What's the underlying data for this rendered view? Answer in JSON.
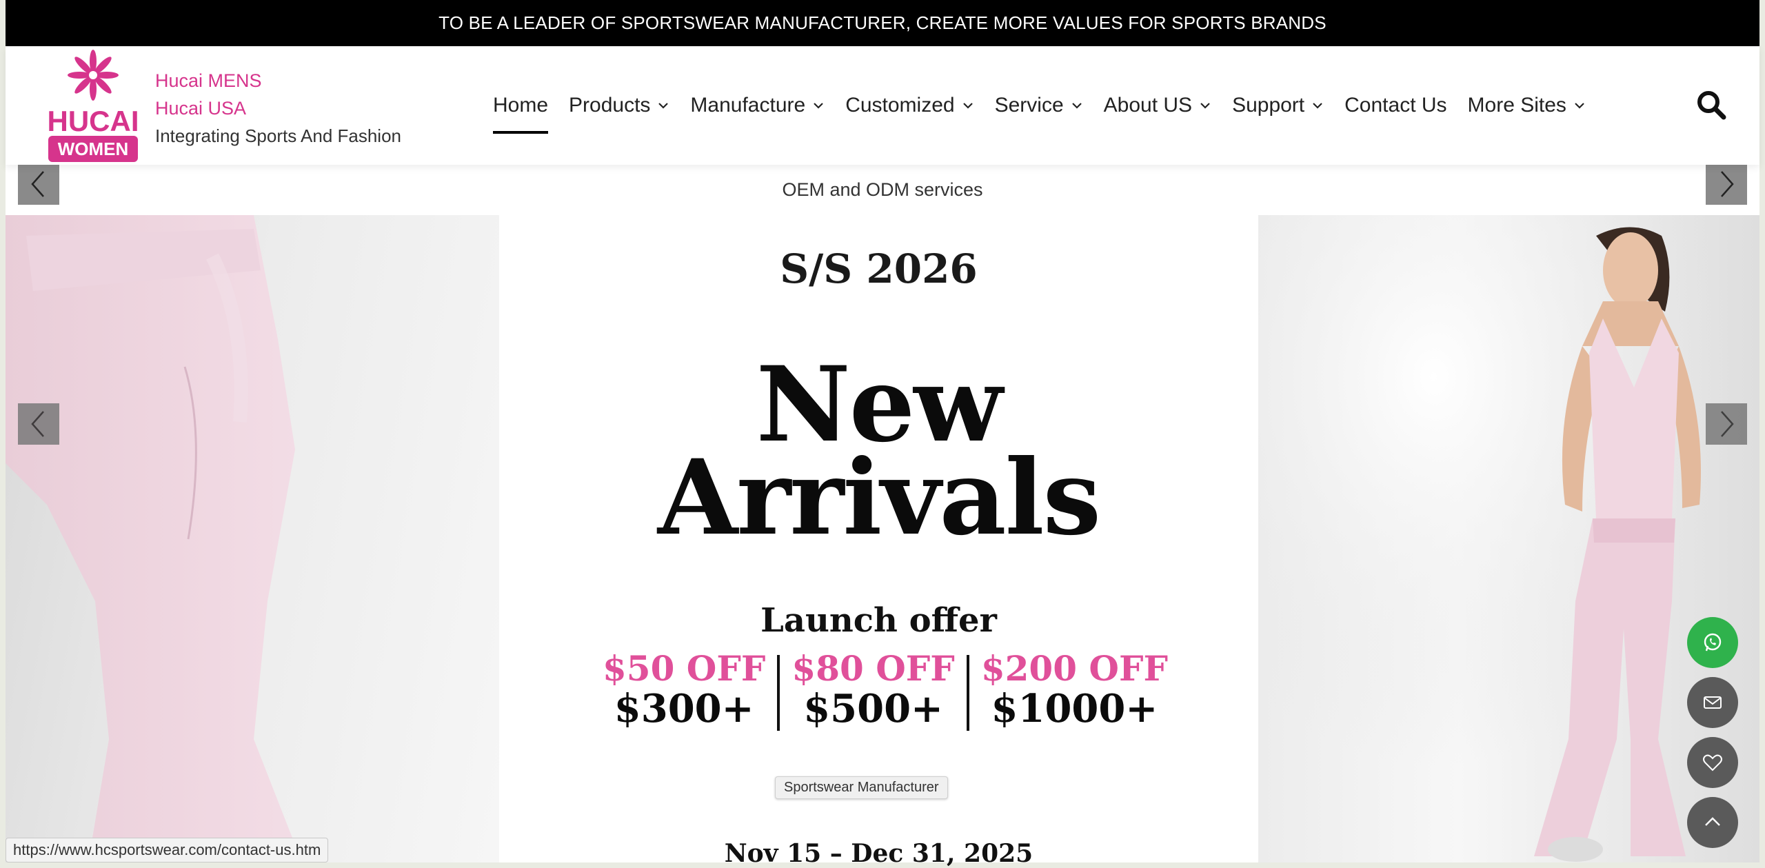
{
  "top_banner": {
    "text": "TO BE A LEADER OF SPORTSWEAR MANUFACTURER, CREATE MORE VALUES FOR SPORTS BRANDS"
  },
  "header": {
    "logo_text": "HUCAI",
    "logo_badge": "WOMEN",
    "brand_links": [
      "Hucai MENS",
      "Hucai USA"
    ],
    "tagline": "Integrating Sports And Fashion"
  },
  "nav": {
    "items": [
      {
        "label": "Home",
        "active": true,
        "dropdown": false
      },
      {
        "label": "Products",
        "active": false,
        "dropdown": true
      },
      {
        "label": "Manufacture",
        "active": false,
        "dropdown": true
      },
      {
        "label": "Customized",
        "active": false,
        "dropdown": true
      },
      {
        "label": "Service",
        "active": false,
        "dropdown": true
      },
      {
        "label": "About US",
        "active": false,
        "dropdown": true
      },
      {
        "label": "Support",
        "active": false,
        "dropdown": true
      },
      {
        "label": "Contact Us",
        "active": false,
        "dropdown": false
      },
      {
        "label": "More Sites",
        "active": false,
        "dropdown": true
      }
    ],
    "search_icon": "search-icon"
  },
  "slider": {
    "caption": "OEM and ODM services",
    "season": "S/S 2026",
    "headline_line1": "New",
    "headline_line2": "Arrivals",
    "launch_offer": "Launch offer",
    "offers": [
      {
        "off": "$50 OFF",
        "min": "$300+"
      },
      {
        "off": "$80 OFF",
        "min": "$500+"
      },
      {
        "off": "$200 OFF",
        "min": "$1000+"
      }
    ],
    "badge": "Sportswear Manufacturer",
    "dates": "Nov 15 – Dec 31, 2025",
    "colors": {
      "pink": "#e0509a",
      "brand": "#d6348c"
    }
  },
  "floating_buttons": [
    "whatsapp-icon",
    "mail-icon",
    "heart-icon",
    "chevron-up-icon"
  ],
  "status_bar": {
    "url": "https://www.hcsportswear.com/contact-us.htm"
  }
}
